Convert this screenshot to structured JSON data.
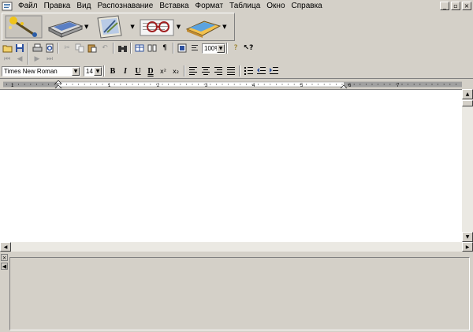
{
  "menu": {
    "items": [
      "Файл",
      "Правка",
      "Вид",
      "Распознавание",
      "Вставка",
      "Формат",
      "Таблица",
      "Окно",
      "Справка"
    ],
    "window_controls": [
      "_",
      "▫",
      "×"
    ]
  },
  "big_toolbar": [
    {
      "name": "wizard-button",
      "icon": "magic-wand-icon",
      "has_arrow": false
    },
    {
      "name": "scan-button",
      "icon": "scanner-icon",
      "has_arrow": true
    },
    {
      "name": "open-image-button",
      "icon": "image-file-icon",
      "has_arrow": true
    },
    {
      "name": "recognize-button",
      "icon": "glasses-icon",
      "has_arrow": true
    },
    {
      "name": "send-button",
      "icon": "book-export-icon",
      "has_arrow": true
    }
  ],
  "standard_toolbar": {
    "zoom": "100%"
  },
  "format_toolbar": {
    "font": "Times New Roman",
    "size": "14",
    "bold": "B",
    "italic": "I",
    "underline": "U",
    "double_underline": "D",
    "superscript": "x²",
    "subscript": "x₂"
  },
  "ruler": {
    "numbers": [
      "1",
      "1",
      "2",
      "3",
      "4",
      "5",
      "6",
      "7"
    ]
  },
  "colors": {
    "chrome": "#d4d0c8",
    "document": "#ffffff",
    "scroll_track": "#ebe9e3"
  }
}
